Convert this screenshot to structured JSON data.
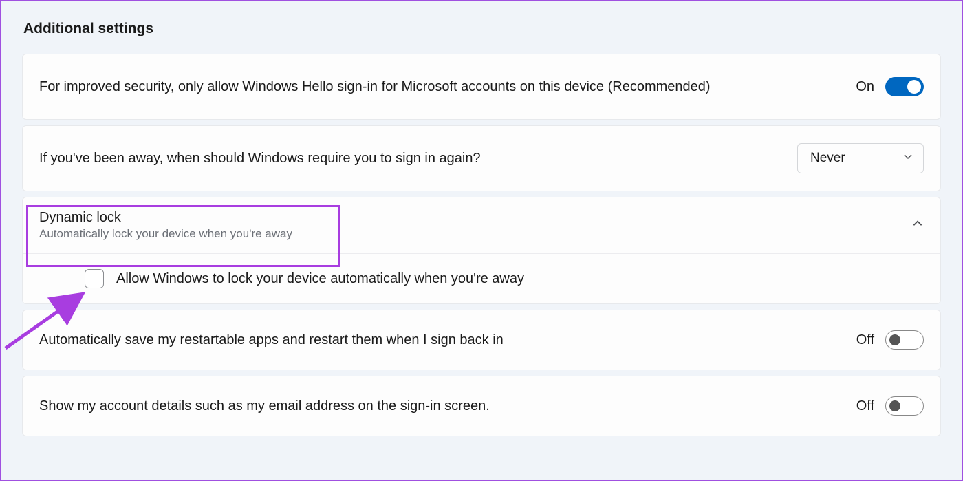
{
  "section_title": "Additional settings",
  "rows": {
    "hello": {
      "label": "For improved security, only allow Windows Hello sign-in for Microsoft accounts on this device (Recommended)",
      "state": "On"
    },
    "away": {
      "label": "If you've been away, when should Windows require you to sign in again?",
      "dropdown_value": "Never"
    },
    "dynamic_lock": {
      "title": "Dynamic lock",
      "subtitle": "Automatically lock your device when you're away",
      "checkbox_label": "Allow Windows to lock your device automatically when you're away"
    },
    "restart_apps": {
      "label": "Automatically save my restartable apps and restart them when I sign back in",
      "state": "Off"
    },
    "account_details": {
      "label": "Show my account details such as my email address on the sign-in screen.",
      "state": "Off"
    }
  }
}
